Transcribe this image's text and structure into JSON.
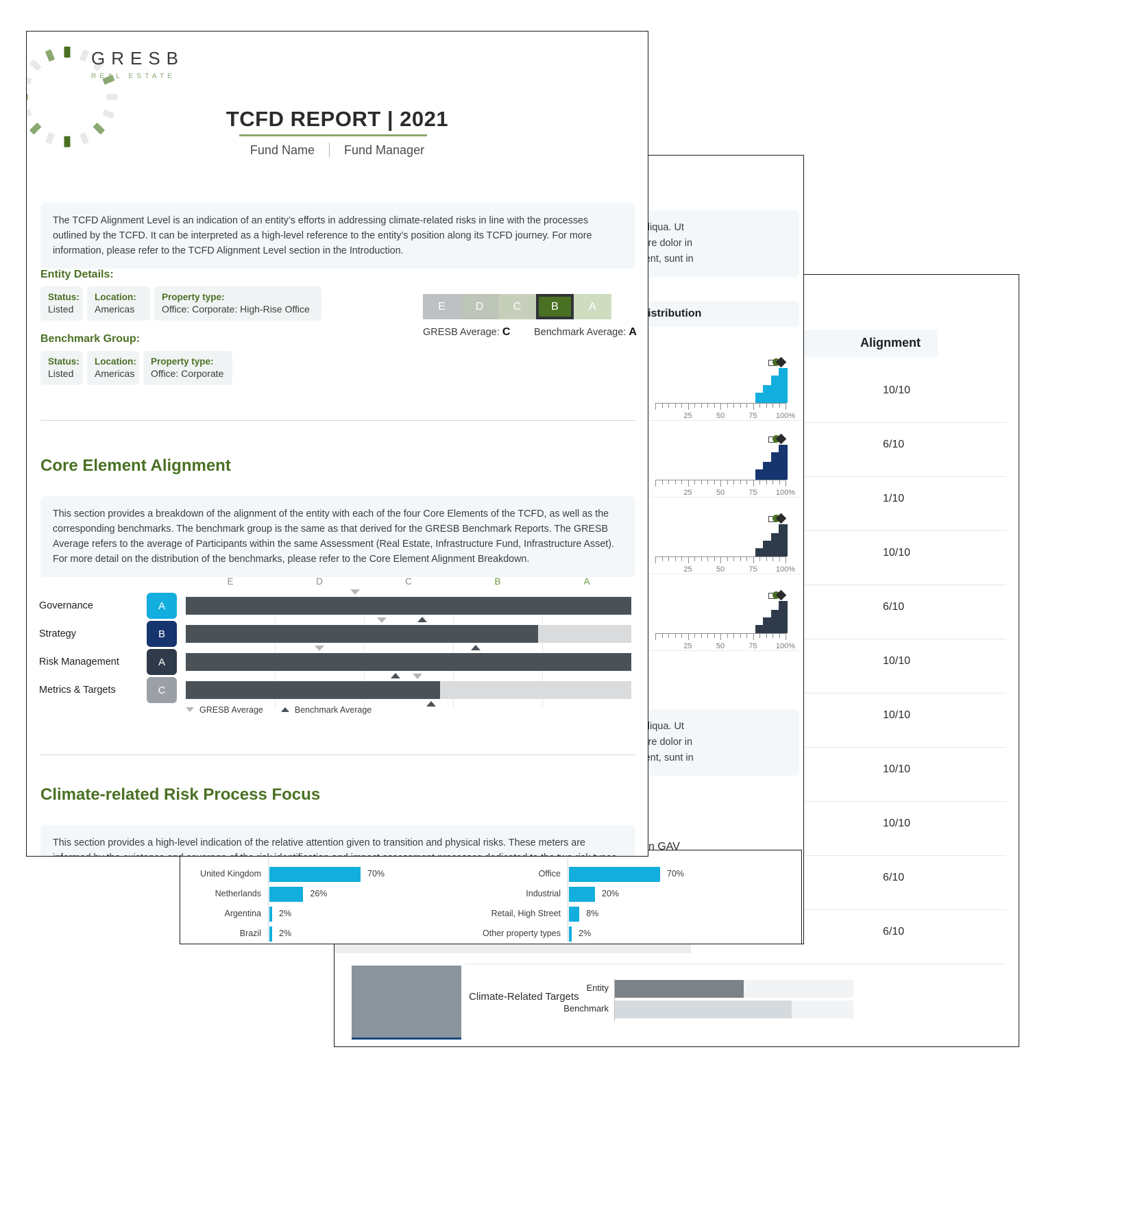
{
  "brand": {
    "logo_title": "GRESB",
    "logo_subtitle": "REAL ESTATE",
    "green": "#4a7023",
    "light_green": "#8aa870",
    "cyan": "#12aede",
    "navy": "#16356f",
    "dark_slate": "#2f3b4a",
    "gray": "#9aa0a6"
  },
  "page1": {
    "title": "TCFD REPORT | 2021",
    "subtitle_left": "Fund Name",
    "subtitle_right": "Fund Manager",
    "intro_note": "The TCFD Alignment Level is an indication of an entity’s efforts in addressing climate-related risks in line with the processes outlined by the TCFD. It can be interpreted as a high-level reference to the entity’s position along its TCFD journey. For more information, please refer to the TCFD Alignment Level section in the Introduction.",
    "entity_details_label": "Entity Details:",
    "entity_details": [
      {
        "key": "Status:",
        "value": "Listed"
      },
      {
        "key": "Location:",
        "value": "Americas"
      },
      {
        "key": "Property type:",
        "value": "Office: Corporate: High-Rise Office"
      }
    ],
    "benchmark_group_label": "Benchmark Group:",
    "benchmark_group": [
      {
        "key": "Status:",
        "value": "Listed"
      },
      {
        "key": "Location:",
        "value": "Americas"
      },
      {
        "key": "Property type:",
        "value": "Office: Corporate"
      }
    ],
    "scale": {
      "cells": [
        "E",
        "D",
        "C",
        "B",
        "A"
      ],
      "selected": "B",
      "gresb_average_label": "GRESB Average:",
      "gresb_average_value": "C",
      "benchmark_average_label": "Benchmark Average:",
      "benchmark_average_value": "A"
    },
    "core_element": {
      "heading": "Core Element Alignment",
      "note": "This section provides a breakdown of the alignment of the entity with each of the four Core Elements of the TCFD, as well as the corresponding benchmarks. The benchmark group is the same as that derived for the GRESB Benchmark Reports. The GRESB Average refers to the average of Participants within the same Assessment (Real Estate, Infrastructure Fund, Infrastructure Asset). For more detail on the distribution of the benchmarks, please refer to the Core Element Alignment Breakdown.",
      "legend_gresb": "GRESB Average",
      "legend_benchmark": "Benchmark Average"
    },
    "risk_focus": {
      "heading": "Climate-related Risk Process Focus",
      "note": "This section provides a high-level indication of the relative attention given to transition and physical risks. These meters are informed by the existence and coverage of the risk identification and impact assessment processes dedicated to the two risk types. A large"
    }
  },
  "chart_data": [
    {
      "type": "bar",
      "name": "core-element-alignment",
      "title": "Core Element Alignment",
      "orientation": "horizontal",
      "categories": [
        "Governance",
        "Strategy",
        "Risk Management",
        "Metrics & Targets"
      ],
      "grades": [
        "A",
        "B",
        "A",
        "C"
      ],
      "grade_colors": [
        "#12aede",
        "#16356f",
        "#2f3b4a",
        "#9aa0a6"
      ],
      "values": [
        100,
        79,
        100,
        57
      ],
      "xlabel": "",
      "ylabel": "",
      "xlim": [
        0,
        100
      ],
      "xtick_labels": [
        "E",
        "D",
        "C",
        "B",
        "A"
      ],
      "xtick_positions": [
        10,
        30,
        50,
        70,
        90
      ],
      "series": [
        {
          "name": "Entity",
          "values": [
            100,
            79,
            100,
            57
          ]
        },
        {
          "name": "GRESB Average",
          "values": [
            38,
            44,
            30,
            52
          ]
        },
        {
          "name": "Benchmark Average",
          "values": [
            53,
            65,
            47,
            55
          ]
        }
      ],
      "legend": [
        "GRESB Average",
        "Benchmark Average"
      ],
      "legend_position": "bottom",
      "grid": true
    },
    {
      "type": "bar",
      "name": "benchmark-distribution-governance",
      "title": "Benchmark Distribution",
      "x": [
        80,
        86,
        92,
        98
      ],
      "values": [
        28,
        48,
        72,
        92
      ],
      "xtick_labels": [
        "25",
        "50",
        "75",
        "100%"
      ],
      "xlim": [
        0,
        100
      ],
      "ylabel": "",
      "bar_color": "#12aede",
      "markers": [
        {
          "kind": "square",
          "label": "Entity",
          "x": 90
        },
        {
          "kind": "circle",
          "label": "GRESB Average",
          "x": 93
        },
        {
          "kind": "diamond",
          "label": "Benchmark Average",
          "x": 97
        }
      ]
    },
    {
      "type": "bar",
      "name": "benchmark-distribution-strategy",
      "title": "Benchmark Distribution",
      "x": [
        80,
        86,
        92,
        98
      ],
      "values": [
        28,
        48,
        72,
        92
      ],
      "xtick_labels": [
        "25",
        "50",
        "75",
        "100%"
      ],
      "xlim": [
        0,
        100
      ],
      "bar_color": "#16356f",
      "markers": [
        {
          "kind": "square",
          "label": "Entity",
          "x": 90
        },
        {
          "kind": "circle",
          "label": "GRESB Average",
          "x": 93
        },
        {
          "kind": "diamond",
          "label": "Benchmark Average",
          "x": 97
        }
      ]
    },
    {
      "type": "bar",
      "name": "benchmark-distribution-risk-management",
      "title": "Benchmark Distribution",
      "x": [
        80,
        86,
        92,
        98
      ],
      "values": [
        22,
        42,
        62,
        86
      ],
      "xtick_labels": [
        "25",
        "50",
        "75",
        "100%"
      ],
      "xlim": [
        0,
        100
      ],
      "bar_color": "#2f3b4a",
      "markers": [
        {
          "kind": "square",
          "label": "Entity",
          "x": 90
        },
        {
          "kind": "circle",
          "label": "GRESB Average",
          "x": 93
        },
        {
          "kind": "diamond",
          "label": "Benchmark Average",
          "x": 97
        }
      ]
    },
    {
      "type": "bar",
      "name": "benchmark-distribution-metrics-targets",
      "title": "Benchmark Distribution",
      "x": [
        80,
        86,
        92,
        98
      ],
      "values": [
        22,
        42,
        62,
        86
      ],
      "xtick_labels": [
        "25",
        "50",
        "75",
        "100%"
      ],
      "xlim": [
        0,
        100
      ],
      "bar_color": "#2f3b4a",
      "markers": [
        {
          "kind": "square",
          "label": "Entity",
          "x": 90
        },
        {
          "kind": "circle",
          "label": "GRESB Average",
          "x": 93
        },
        {
          "kind": "diamond",
          "label": "Benchmark Average",
          "x": 97
        }
      ]
    },
    {
      "type": "bar",
      "name": "countries-by-gav",
      "title": "",
      "orientation": "horizontal",
      "categories": [
        "United Kingdom",
        "Netherlands",
        "Argentina",
        "Brazil"
      ],
      "values": [
        70,
        26,
        2,
        2
      ],
      "value_labels": [
        "70%",
        "26%",
        "2%",
        "2%"
      ],
      "bar_color": "#12aede",
      "xlim": [
        0,
        100
      ]
    },
    {
      "type": "bar",
      "name": "property-types-by-gav",
      "title": "",
      "orientation": "horizontal",
      "categories": [
        "Office",
        "Industrial",
        "Retail, High Street",
        "Other property types"
      ],
      "values": [
        70,
        20,
        8,
        2
      ],
      "value_labels": [
        "70%",
        "20%",
        "8%",
        "2%"
      ],
      "bar_color": "#12aede",
      "xlim": [
        0,
        100
      ]
    },
    {
      "type": "bar",
      "name": "climate-related-targets",
      "title": "Climate-Related Targets",
      "orientation": "horizontal",
      "categories": [
        "Entity",
        "Benchmark"
      ],
      "values": [
        54,
        74
      ],
      "colors": [
        "#7b8288",
        "#d4dadd"
      ],
      "xlim": [
        0,
        100
      ]
    }
  ],
  "page2": {
    "note_top": "dolore magna aliqua. Ut\nat. Duis aute irure dolor in\ndatat non proident, sunt in",
    "note_top_line1": "dolore magna aliqua. Ut",
    "note_top_line2": "at. Duis aute irure dolor in",
    "note_top_line3": "datat non proident, sunt in",
    "bd_heading": "Benchmark Distribution",
    "note_bottom_line1": "dolore magna aliqua. Ut",
    "note_bottom_line2": "at. Duis aute irure dolor in",
    "note_bottom_line3": "datat non proident, sunt in",
    "gav_title": "n GAV"
  },
  "page3": {
    "table_header_alignment": "Alignment",
    "rows": [
      {
        "alignment": "10/10",
        "bar_pct": 100,
        "bar_color": "#12aede",
        "sub_pct": 0
      },
      {
        "alignment": "6/10",
        "bar_pct": 0,
        "bar_color": "#12aede",
        "sub_pct": 14
      },
      {
        "alignment": "1/10",
        "bar_pct": 0,
        "bar_color": "#16356f",
        "sub_pct": 0
      },
      {
        "alignment": "10/10",
        "bar_pct": 100,
        "bar_color": "#16356f",
        "sub_pct": 0
      },
      {
        "alignment": "6/10",
        "bar_pct": 0,
        "bar_color": "#16356f",
        "sub_pct": 0
      },
      {
        "alignment": "10/10",
        "bar_pct": 100,
        "bar_color": "#2f3b4a",
        "sub_pct": 0
      },
      {
        "alignment": "10/10",
        "bar_pct": 100,
        "bar_color": "#2f3b4a",
        "sub_pct": 0
      },
      {
        "alignment": "10/10",
        "bar_pct": 100,
        "bar_color": "#2f3b4a",
        "sub_pct": 0
      },
      {
        "alignment": "10/10",
        "bar_pct": 100,
        "bar_color": "#8b939c",
        "sub_pct": 0
      },
      {
        "alignment": "6/10",
        "bar_pct": 0,
        "bar_color": "#8b939c",
        "sub_pct": 0
      },
      {
        "alignment": "6/10",
        "bar_pct": 0,
        "bar_color": "#8b939c",
        "sub_pct": 0
      }
    ],
    "climate_targets_label": "Climate-Related Targets",
    "climate_targets_entity": "Entity",
    "climate_targets_benchmark": "Benchmark"
  }
}
